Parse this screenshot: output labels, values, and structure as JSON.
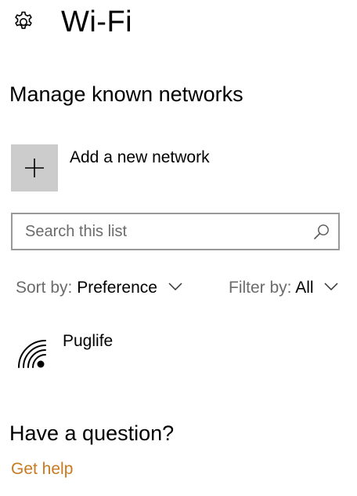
{
  "header": {
    "title": "Wi-Fi",
    "icon": "gear-icon"
  },
  "manage": {
    "heading": "Manage known networks",
    "add_network_label": "Add a new network",
    "add_icon": "plus-icon"
  },
  "search": {
    "placeholder": "Search this list",
    "value": "",
    "icon": "search-icon"
  },
  "sort": {
    "label": "Sort by:",
    "value": "Preference"
  },
  "filter": {
    "label": "Filter by:",
    "value": "All"
  },
  "networks": [
    {
      "name": "Puglife",
      "icon": "wifi-icon"
    }
  ],
  "help": {
    "heading": "Have a question?",
    "link": "Get help"
  },
  "colors": {
    "background": "#ffffff",
    "tile": "#cccccc",
    "search_border": "#999999",
    "muted_text": "#6b6b6b",
    "link": "#c87a20"
  }
}
